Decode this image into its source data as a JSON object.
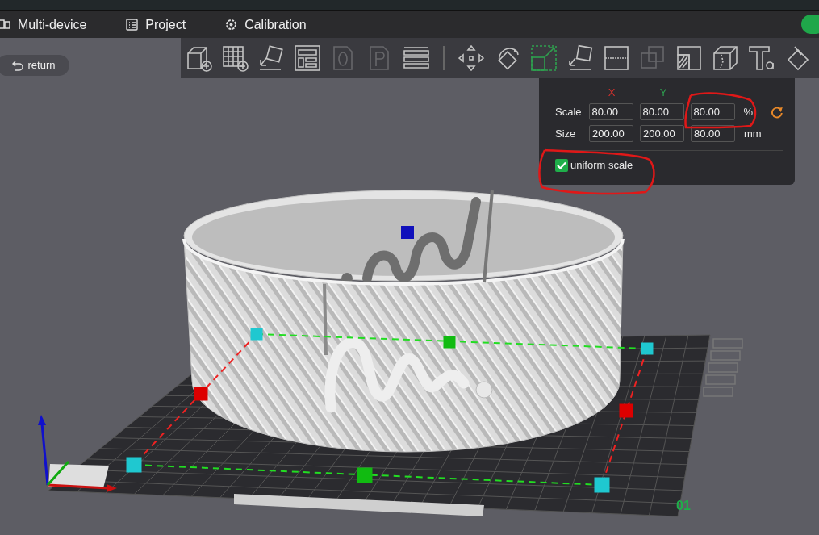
{
  "tabs": [
    {
      "kind": "multi-device",
      "label": "Multi-device"
    },
    {
      "kind": "project",
      "label": "Project"
    },
    {
      "kind": "calibration",
      "label": "Calibration"
    }
  ],
  "return_button": {
    "label": "return"
  },
  "toolbar": [
    {
      "kind": "add-cube",
      "selected": false,
      "disabled": false
    },
    {
      "kind": "add-plate",
      "selected": false,
      "disabled": false
    },
    {
      "kind": "auto-orient",
      "selected": false,
      "disabled": false
    },
    {
      "kind": "arrange",
      "selected": false,
      "disabled": false
    },
    {
      "kind": "doc-o",
      "selected": false,
      "disabled": true
    },
    {
      "kind": "doc-p",
      "selected": false,
      "disabled": true
    },
    {
      "kind": "layers",
      "selected": false,
      "disabled": false
    }
  ],
  "toolbar_2": [
    {
      "kind": "move",
      "selected": false,
      "disabled": false
    },
    {
      "kind": "rotate",
      "selected": false,
      "disabled": false
    },
    {
      "kind": "scale",
      "selected": true,
      "disabled": false
    },
    {
      "kind": "lay-flat",
      "selected": false,
      "disabled": false
    },
    {
      "kind": "cut",
      "selected": false,
      "disabled": false
    },
    {
      "kind": "boolean",
      "selected": false,
      "disabled": true
    },
    {
      "kind": "seam",
      "selected": false,
      "disabled": false
    },
    {
      "kind": "cube-cut",
      "selected": false,
      "disabled": false
    },
    {
      "kind": "text",
      "selected": false,
      "disabled": false
    },
    {
      "kind": "paint",
      "selected": false,
      "disabled": false
    }
  ],
  "scale_panel": {
    "axes": [
      {
        "label": "X",
        "color": "#d0312d"
      },
      {
        "label": "Y",
        "color": "#2e9e4f"
      }
    ],
    "rows": [
      {
        "label": "Scale",
        "values": [
          "80.00",
          "80.00",
          "80.00"
        ],
        "unit": "%",
        "reset": true
      },
      {
        "label": "Size",
        "values": [
          "200.00",
          "200.00",
          "80.00"
        ],
        "unit": "mm",
        "reset": false
      }
    ],
    "uniform_scale": {
      "label": "uniform scale",
      "checked": true
    }
  },
  "viewport": {
    "plate_number": "01"
  }
}
